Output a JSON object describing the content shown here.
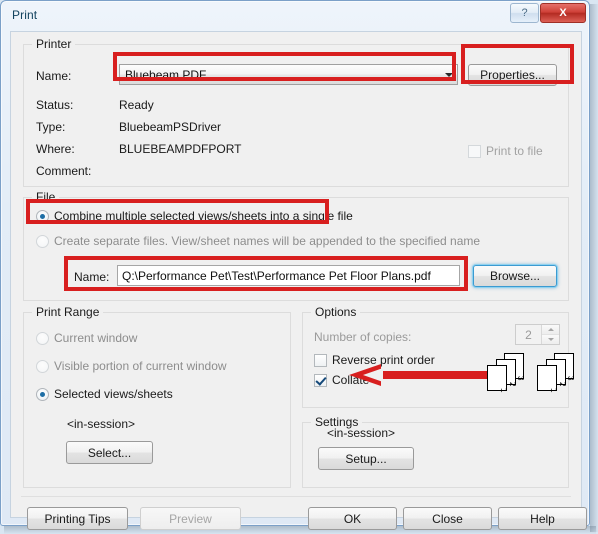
{
  "window": {
    "title": "Print",
    "help_button": "?",
    "close_button": "X"
  },
  "printer": {
    "group_title": "Printer",
    "name_label": "Name:",
    "name_value": "Bluebeam PDF",
    "properties_button": "Properties...",
    "status_label": "Status:",
    "status_value": "Ready",
    "type_label": "Type:",
    "type_value": "BluebeamPSDriver",
    "where_label": "Where:",
    "where_value": "BLUEBEAMPDFPORT",
    "comment_label": "Comment:",
    "comment_value": "",
    "print_to_file_label": "Print to file",
    "print_to_file_checked": false,
    "print_to_file_enabled": false
  },
  "file": {
    "group_title": "File",
    "option_combine": "Combine multiple selected views/sheets into a single file",
    "option_separate": "Create separate files. View/sheet names will be appended to the specified name",
    "selected_option": "combine",
    "name_label": "Name:",
    "name_value": "Q:\\Performance Pet\\Test\\Performance Pet Floor Plans.pdf",
    "browse_button": "Browse..."
  },
  "print_range": {
    "group_title": "Print Range",
    "options": [
      {
        "label": "Current window",
        "checked": false
      },
      {
        "label": "Visible portion of current window",
        "checked": false
      },
      {
        "label": "Selected views/sheets",
        "checked": true
      }
    ],
    "session_label": "<in-session>",
    "select_button": "Select..."
  },
  "options": {
    "group_title": "Options",
    "copies_label": "Number of copies:",
    "copies_value": "2",
    "copies_enabled": false,
    "reverse_label": "Reverse print order",
    "reverse_checked": false,
    "collate_label": "Collate",
    "collate_checked": true,
    "page_numbers": [
      "1",
      "2",
      "3"
    ]
  },
  "settings": {
    "group_title": "Settings",
    "session_label": "<in-session>",
    "setup_button": "Setup..."
  },
  "footer": {
    "printing_tips_button": "Printing Tips",
    "preview_button": "Preview",
    "preview_enabled": false,
    "ok_button": "OK",
    "close_button": "Close",
    "help_button": "Help"
  },
  "annotations": {
    "highlight_color": "#d81f1f",
    "boxes": [
      "printer-name-combo",
      "properties-button",
      "combine-option",
      "file-name-field"
    ],
    "arrows": [
      "collate-arrow"
    ]
  }
}
